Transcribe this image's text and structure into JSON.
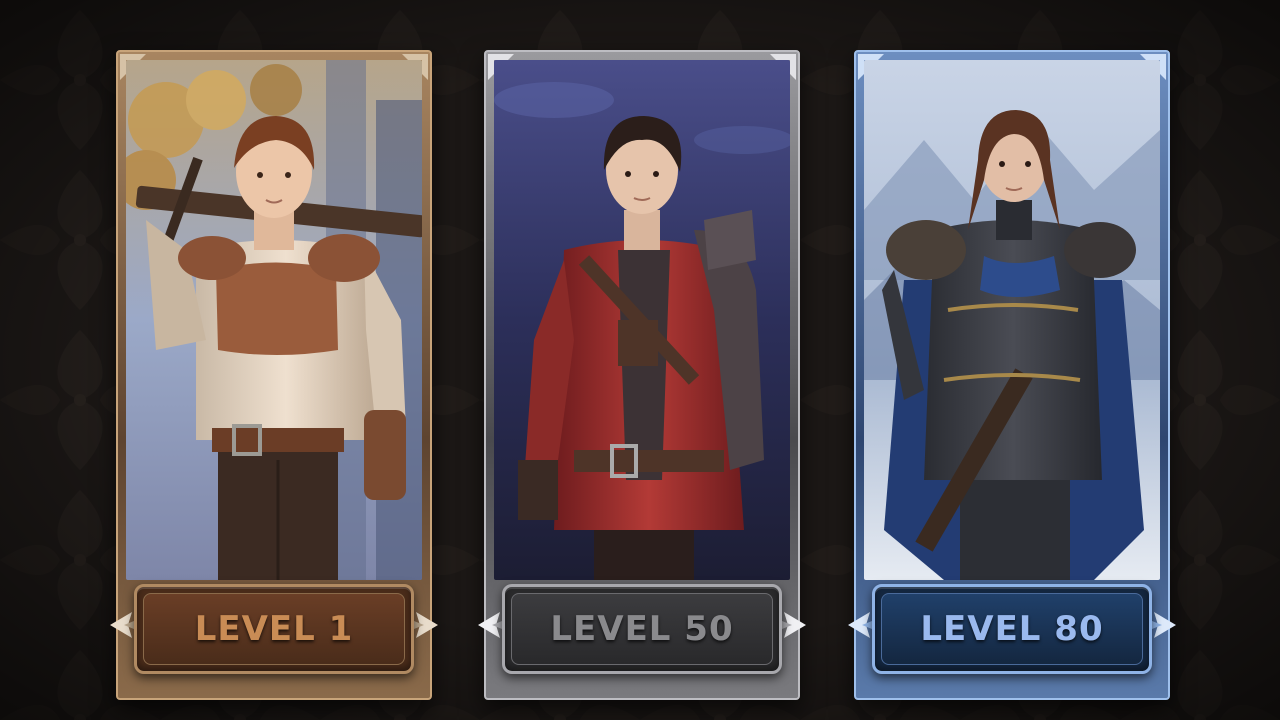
{
  "cards": [
    {
      "label": "LEVEL 1",
      "theme": {
        "frame": "#8a6a4a",
        "frame_light": "#c8a47a",
        "plate": "#4a2c1a",
        "plate_inner": "#5d3621",
        "plate_border": "#b08a62",
        "text": "#c98c55",
        "accent": "#d6c2a6"
      },
      "portrait": "novice-adventurer",
      "scene": "autumn-forest"
    },
    {
      "label": "LEVEL 50",
      "theme": {
        "frame": "#5a5a5e",
        "frame_light": "#bdbdc2",
        "plate": "#2a2a2c",
        "plate_inner": "#343436",
        "plate_border": "#a8a8ad",
        "text": "#8a8a8d",
        "accent": "#e2e2e6"
      },
      "portrait": "crimson-swordsman",
      "scene": "night-sky"
    },
    {
      "label": "LEVEL 80",
      "theme": {
        "frame": "#4a6a9a",
        "frame_light": "#9fc0ec",
        "plate": "#142740",
        "plate_inner": "#1b3355",
        "plate_border": "#8fb3e6",
        "text": "#9ab9ee",
        "accent": "#cfe0f7"
      },
      "portrait": "armored-knight",
      "scene": "misty-mountains"
    }
  ]
}
